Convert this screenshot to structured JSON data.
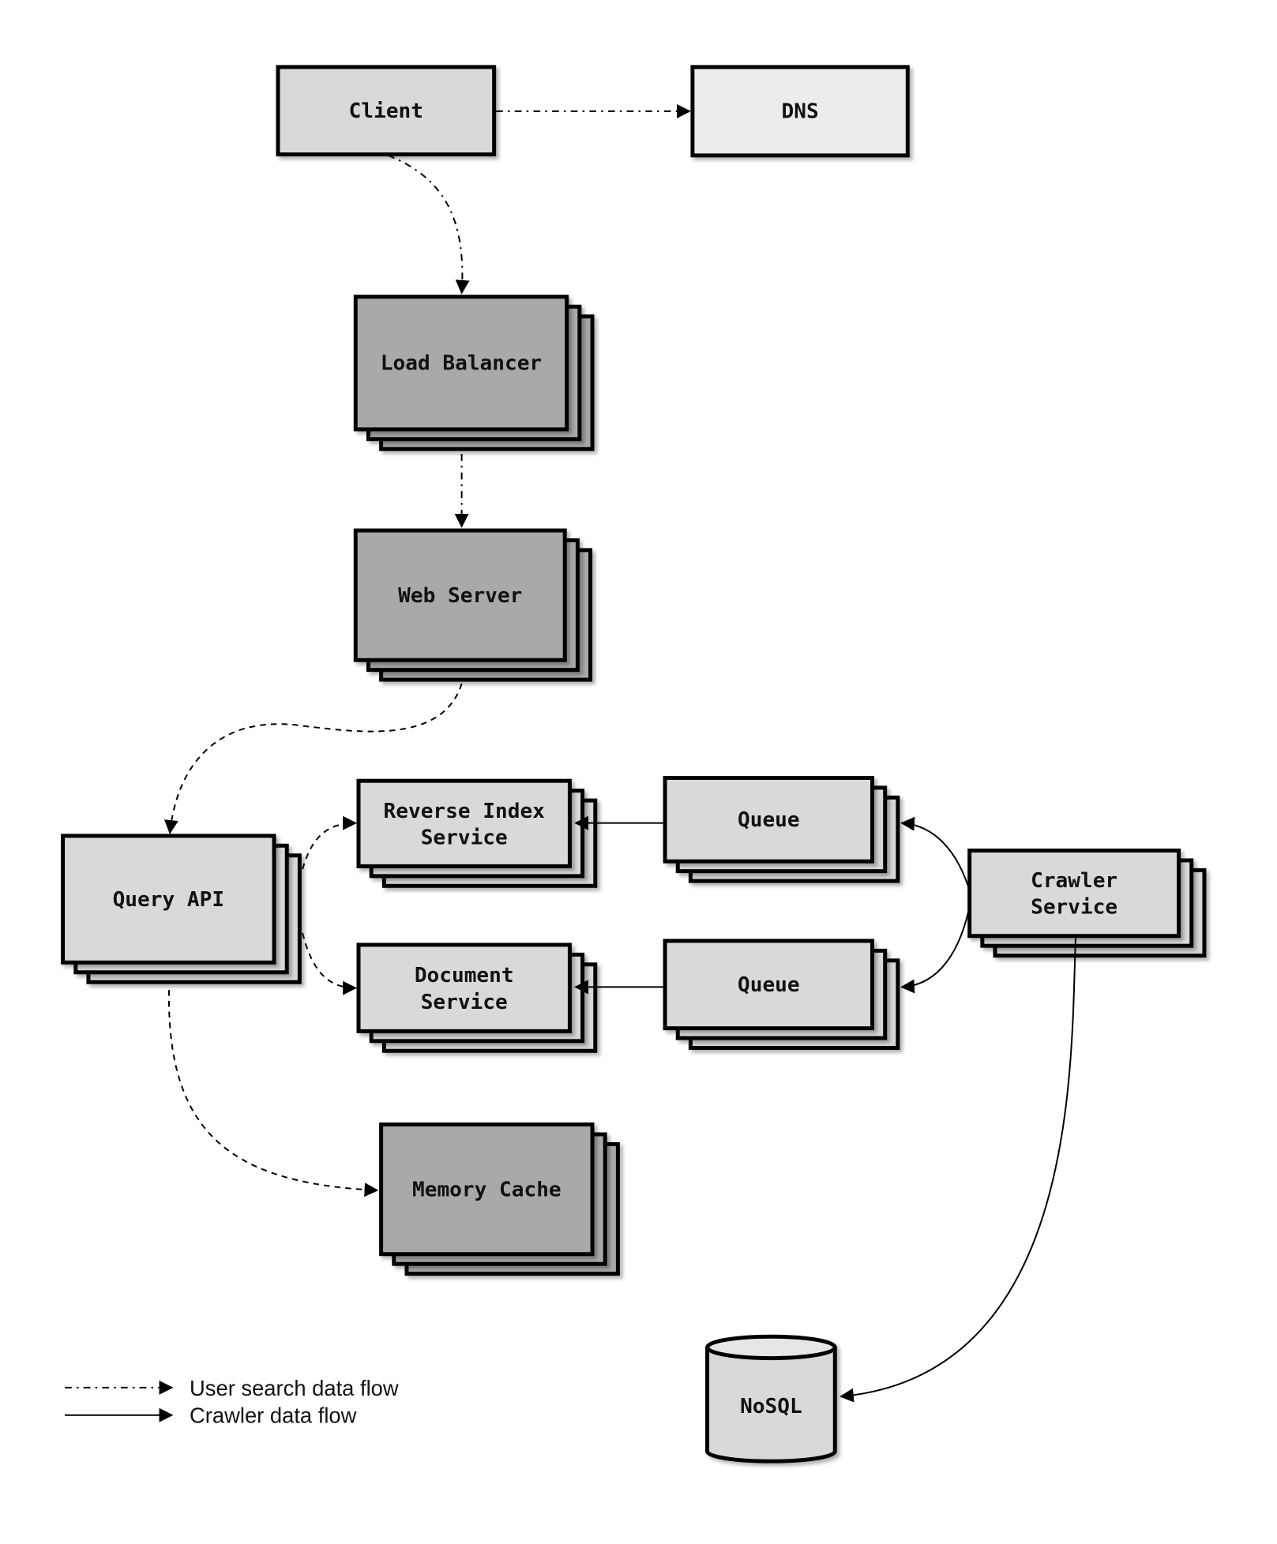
{
  "nodes": {
    "client": {
      "label": "Client"
    },
    "dns": {
      "label": "DNS"
    },
    "load_balancer": {
      "label": "Load Balancer"
    },
    "web_server": {
      "label": "Web Server"
    },
    "query_api": {
      "label": "Query API"
    },
    "reverse_index": {
      "line1": "Reverse Index",
      "line2": "Service"
    },
    "document": {
      "line1": "Document",
      "line2": "Service"
    },
    "queue_top": {
      "label": "Queue"
    },
    "queue_bottom": {
      "label": "Queue"
    },
    "crawler": {
      "line1": "Crawler",
      "line2": "Service"
    },
    "memory_cache": {
      "label": "Memory Cache"
    },
    "nosql": {
      "label": "NoSQL"
    }
  },
  "legend": {
    "user_flow": "User search data flow",
    "crawler_flow": "Crawler data flow"
  },
  "colors": {
    "dark_box": "#a9a9a9",
    "light_box": "#d9d9d9",
    "dns_box": "#ececec"
  }
}
